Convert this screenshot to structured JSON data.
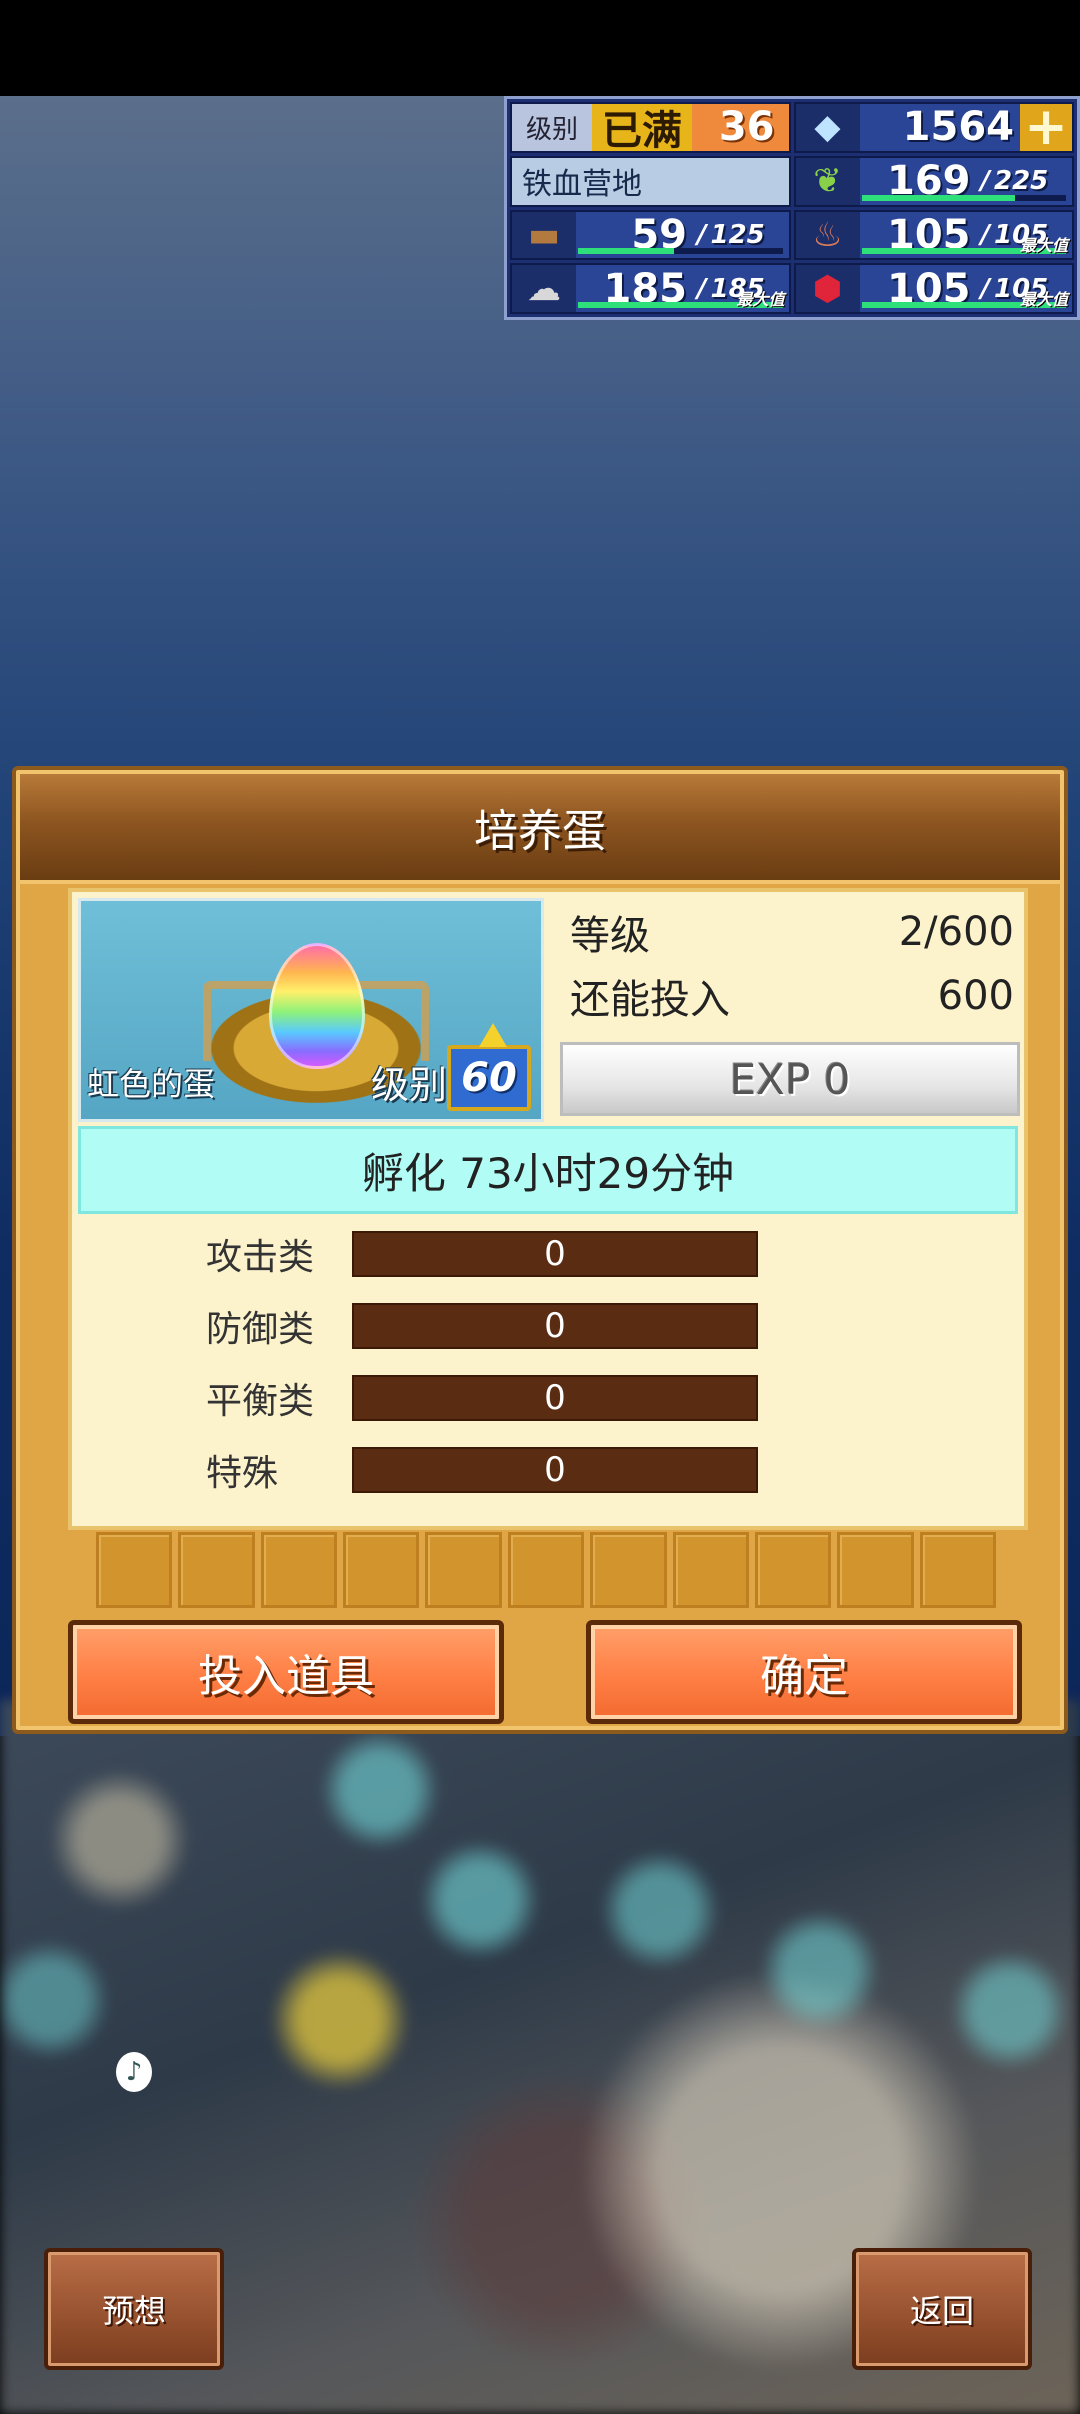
{
  "hud": {
    "level_label": "级别",
    "level_max_badge": "已满",
    "level_value": "36",
    "gems": "1564",
    "base_name": "铁血营地",
    "resources": [
      {
        "icon": "grass-icon",
        "value": "169",
        "max": "225",
        "fill": 0.75,
        "tag": ""
      },
      {
        "icon": "wood-icon",
        "value": "59",
        "max": "125",
        "fill": 0.47,
        "tag": ""
      },
      {
        "icon": "food-icon",
        "value": "105",
        "max": "105",
        "fill": 1.0,
        "tag": "最大值"
      },
      {
        "icon": "stone-icon",
        "value": "185",
        "max": "185",
        "fill": 1.0,
        "tag": "最大值"
      },
      {
        "icon": "ruby-icon",
        "value": "105",
        "max": "105",
        "fill": 1.0,
        "tag": "最大值"
      }
    ]
  },
  "dialog": {
    "title": "培养蛋",
    "egg_name": "虹色的蛋",
    "egg_level_label": "级别",
    "egg_level_value": "60",
    "grade_label": "等级",
    "grade_value": "2/600",
    "remaining_label": "还能投入",
    "remaining_value": "600",
    "exp_text": "EXP 0",
    "hatch_text": "孵化 73小时29分钟",
    "attributes": [
      {
        "label": "攻击类",
        "value": "0"
      },
      {
        "label": "防御类",
        "value": "0"
      },
      {
        "label": "平衡类",
        "value": "0"
      },
      {
        "label": "特殊",
        "value": "0"
      }
    ],
    "slot_count": 11,
    "left_button": "投入道具",
    "right_button": "确定"
  },
  "bottom": {
    "left_button": "预想",
    "right_button": "返回"
  }
}
